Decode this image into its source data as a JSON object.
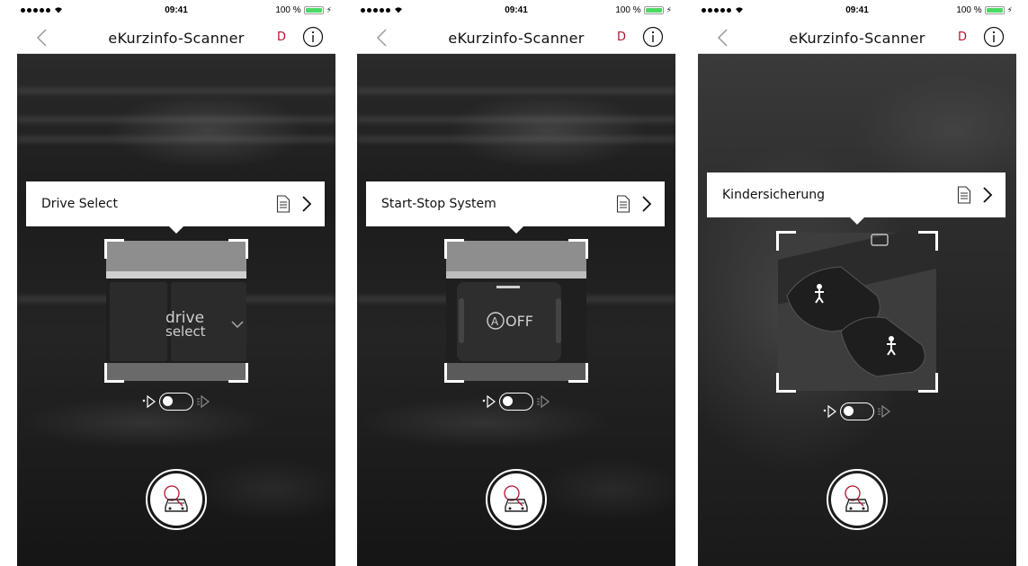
{
  "status_bar": {
    "time": "09:41",
    "battery": "100 %",
    "battery_level_fraction": 1.0
  },
  "nav": {
    "title": "eKurzinfo-Scanner",
    "language": "D"
  },
  "screens": [
    {
      "popup_label": "Drive Select",
      "scan_text_line1": "drive",
      "scan_text_line2": "select"
    },
    {
      "popup_label": "Start-Stop System",
      "scan_text": "OFF"
    },
    {
      "popup_label": "Kindersicherung"
    }
  ],
  "colors": {
    "accent": "#b3132f",
    "battery": "#4cd964"
  },
  "icons": {
    "back": "chevron-left-icon",
    "info": "info-circle-icon",
    "document": "document-icon",
    "chevron": "chevron-right-icon",
    "flash_off": "flash-off-icon",
    "flash_on": "flash-on-icon",
    "scan": "car-scan-icon"
  }
}
